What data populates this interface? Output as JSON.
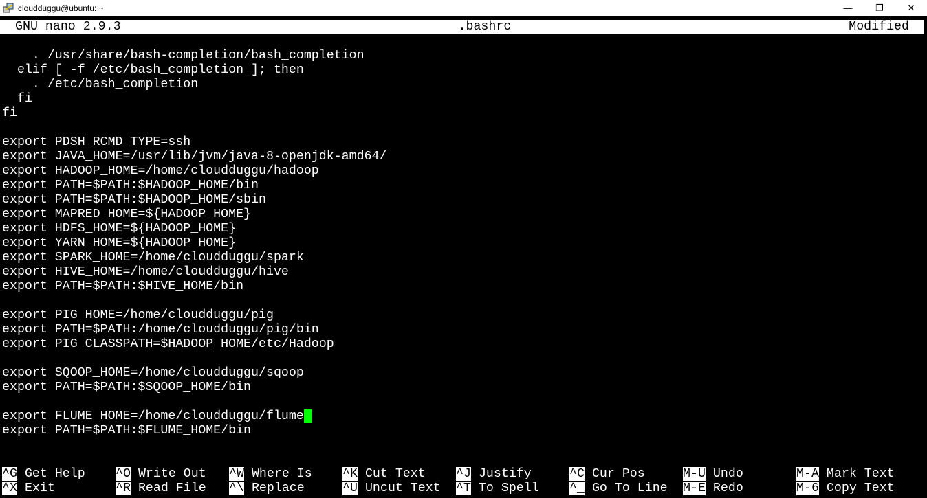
{
  "window": {
    "title": "cloudduggu@ubuntu: ~",
    "controls": [
      "minimize",
      "maximize",
      "close"
    ]
  },
  "header": {
    "app": "GNU nano 2.9.3",
    "filename": ".bashrc",
    "status": "Modified"
  },
  "lines": [
    "",
    "    . /usr/share/bash-completion/bash_completion",
    "  elif [ -f /etc/bash_completion ]; then",
    "    . /etc/bash_completion",
    "  fi",
    "fi",
    "",
    "export PDSH_RCMD_TYPE=ssh",
    "export JAVA_HOME=/usr/lib/jvm/java-8-openjdk-amd64/",
    "export HADOOP_HOME=/home/cloudduggu/hadoop",
    "export PATH=$PATH:$HADOOP_HOME/bin",
    "export PATH=$PATH:$HADOOP_HOME/sbin",
    "export MAPRED_HOME=${HADOOP_HOME}",
    "export HDFS_HOME=${HADOOP_HOME}",
    "export YARN_HOME=${HADOOP_HOME}",
    "export SPARK_HOME=/home/cloudduggu/spark",
    "export HIVE_HOME=/home/cloudduggu/hive",
    "export PATH=$PATH:$HIVE_HOME/bin",
    "",
    "export PIG_HOME=/home/cloudduggu/pig",
    "export PATH=$PATH:/home/cloudduggu/pig/bin",
    "export PIG_CLASSPATH=$HADOOP_HOME/etc/Hadoop",
    "",
    "export SQOOP_HOME=/home/cloudduggu/sqoop",
    "export PATH=$PATH:$SQOOP_HOME/bin",
    "",
    "export FLUME_HOME=/home/cloudduggu/flume",
    "export PATH=$PATH:$FLUME_HOME/bin",
    "",
    ""
  ],
  "cursor": {
    "line": 26,
    "column": 40,
    "color": "#00ff00"
  },
  "shortcuts": [
    [
      {
        "key": "^G",
        "label": "Get Help"
      },
      {
        "key": "^O",
        "label": "Write Out"
      },
      {
        "key": "^W",
        "label": "Where Is"
      },
      {
        "key": "^K",
        "label": "Cut Text"
      },
      {
        "key": "^J",
        "label": "Justify"
      },
      {
        "key": "^C",
        "label": "Cur Pos"
      },
      {
        "key": "M-U",
        "label": "Undo"
      },
      {
        "key": "M-A",
        "label": "Mark Text"
      }
    ],
    [
      {
        "key": "^X",
        "label": "Exit"
      },
      {
        "key": "^R",
        "label": "Read File"
      },
      {
        "key": "^\\",
        "label": "Replace"
      },
      {
        "key": "^U",
        "label": "Uncut Text"
      },
      {
        "key": "^T",
        "label": "To Spell"
      },
      {
        "key": "^_",
        "label": "Go To Line"
      },
      {
        "key": "M-E",
        "label": "Redo"
      },
      {
        "key": "M-6",
        "label": "Copy Text"
      }
    ]
  ]
}
